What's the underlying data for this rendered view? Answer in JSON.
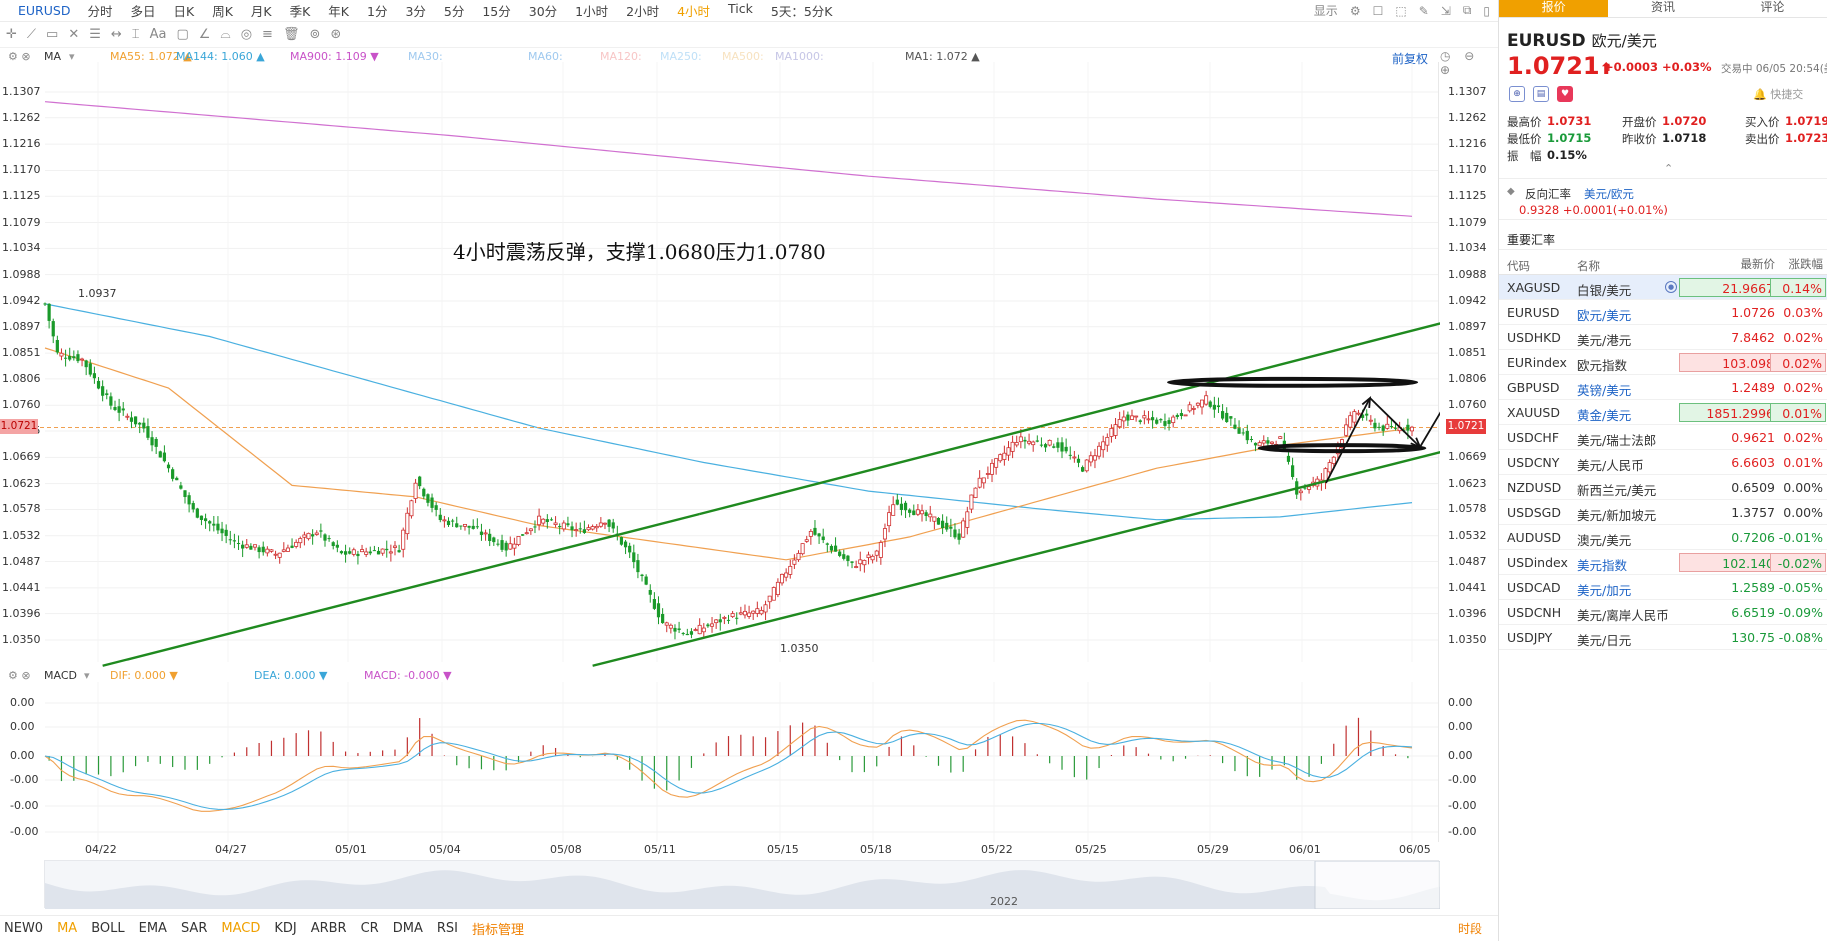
{
  "toolbar": {
    "symbol": "EURUSD",
    "periods": [
      "分时",
      "多日",
      "日K",
      "周K",
      "月K",
      "季K",
      "年K",
      "1分",
      "3分",
      "5分",
      "15分",
      "30分",
      "1小时",
      "2小时",
      "4小时",
      "Tick",
      "5天：5分K"
    ],
    "active_period": "4小时",
    "right": [
      "显示",
      "⚙",
      "☐",
      "⬚",
      "✎",
      "⇲",
      "⧉",
      "▯"
    ]
  },
  "drawtools": [
    "✛",
    "⟋",
    "▭",
    "✕",
    "☰",
    "↔",
    "⌶",
    "Aa",
    "▢",
    "∠",
    "⌓",
    "◎",
    "≡",
    "🗑",
    "⊚",
    "⊛"
  ],
  "ma_bar": {
    "label": "MA",
    "items": [
      {
        "text": "MA55: 1.072 ▲",
        "color": "#f0a030"
      },
      {
        "text": "MA144: 1.060 ▲",
        "color": "#3aa6d8"
      },
      {
        "text": "MA900: 1.109 ▼",
        "color": "#c852c8"
      },
      {
        "text": "MA30:",
        "color": "#9fc9ef"
      },
      {
        "text": "MA60:",
        "color": "#9fc9ef"
      },
      {
        "text": "MA120:",
        "color": "#f7c6c6"
      },
      {
        "text": "MA250:",
        "color": "#bfe0f7"
      },
      {
        "text": "MA500:",
        "color": "#f7e2c0"
      },
      {
        "text": "MA1000:",
        "color": "#c6c6e6"
      },
      {
        "text": "MA1: 1.072 ▲",
        "color": "#555555"
      }
    ],
    "restore": "前复权",
    "controls": "◷ ⊖ ⊕"
  },
  "macd_bar": {
    "label": "MACD",
    "items": [
      {
        "text": "DIF: 0.000 ▼",
        "color": "#f0a030"
      },
      {
        "text": "DEA: 0.000 ▼",
        "color": "#3aa6d8"
      },
      {
        "text": "MACD: -0.000 ▼",
        "color": "#c852c8"
      }
    ]
  },
  "annotation": "4小时震荡反弹，支撑1.0680压力1.0780",
  "labels": {
    "high": "1.0937",
    "low": "1.0350"
  },
  "current_price_tag": "1.0721",
  "chart_data": {
    "type": "candlestick",
    "symbol": "EURUSD",
    "period": "4小时",
    "y_ticks": [
      "1.1307",
      "1.1262",
      "1.1216",
      "1.1170",
      "1.1125",
      "1.1079",
      "1.1034",
      "1.0988",
      "1.0942",
      "1.0897",
      "1.0851",
      "1.0806",
      "1.0760",
      "1.0715",
      "1.0669",
      "1.0623",
      "1.0578",
      "1.0532",
      "1.0487",
      "1.0441",
      "1.0396",
      "1.0350"
    ],
    "ylim": [
      1.0305,
      1.133
    ],
    "x_labels": [
      "04/22",
      "04/27",
      "05/01",
      "05/04",
      "05/08",
      "05/11",
      "05/15",
      "05/18",
      "05/22",
      "05/25",
      "05/29",
      "06/01",
      "06/05"
    ],
    "x_year": "2022",
    "path": [
      [
        0,
        1.0937
      ],
      [
        3,
        1.085
      ],
      [
        9,
        1.084
      ],
      [
        16,
        1.076
      ],
      [
        24,
        1.072
      ],
      [
        30,
        1.065
      ],
      [
        36,
        1.0575
      ],
      [
        46,
        1.052
      ],
      [
        56,
        1.05
      ],
      [
        66,
        1.054
      ],
      [
        72,
        1.05
      ],
      [
        86,
        1.051
      ],
      [
        90,
        1.063
      ],
      [
        96,
        1.056
      ],
      [
        104,
        1.0545
      ],
      [
        112,
        1.051
      ],
      [
        120,
        1.056
      ],
      [
        130,
        1.054
      ],
      [
        136,
        1.056
      ],
      [
        142,
        1.05
      ],
      [
        150,
        1.038
      ],
      [
        156,
        1.036
      ],
      [
        166,
        1.039
      ],
      [
        174,
        1.04
      ],
      [
        180,
        1.047
      ],
      [
        186,
        1.054
      ],
      [
        196,
        1.048
      ],
      [
        202,
        1.05
      ],
      [
        206,
        1.059
      ],
      [
        216,
        1.056
      ],
      [
        222,
        1.053
      ],
      [
        226,
        1.062
      ],
      [
        236,
        1.07
      ],
      [
        246,
        1.069
      ],
      [
        252,
        1.065
      ],
      [
        262,
        1.074
      ],
      [
        272,
        1.073
      ],
      [
        282,
        1.077
      ],
      [
        288,
        1.073
      ],
      [
        294,
        1.069
      ],
      [
        300,
        1.07
      ],
      [
        304,
        1.061
      ],
      [
        310,
        1.063
      ],
      [
        318,
        1.075
      ],
      [
        324,
        1.072
      ],
      [
        332,
        1.0721
      ]
    ],
    "ma55": [
      [
        0,
        1.086
      ],
      [
        30,
        1.079
      ],
      [
        60,
        1.062
      ],
      [
        90,
        1.06
      ],
      [
        120,
        1.055
      ],
      [
        150,
        1.052
      ],
      [
        180,
        1.049
      ],
      [
        210,
        1.053
      ],
      [
        240,
        1.059
      ],
      [
        270,
        1.065
      ],
      [
        300,
        1.069
      ],
      [
        332,
        1.072
      ]
    ],
    "ma144": [
      [
        0,
        1.0937
      ],
      [
        40,
        1.088
      ],
      [
        80,
        1.08
      ],
      [
        120,
        1.072
      ],
      [
        160,
        1.066
      ],
      [
        200,
        1.061
      ],
      [
        240,
        1.058
      ],
      [
        270,
        1.056
      ],
      [
        300,
        1.0565
      ],
      [
        332,
        1.059
      ]
    ],
    "ma900": [
      [
        0,
        1.129
      ],
      [
        100,
        1.123
      ],
      [
        200,
        1.116
      ],
      [
        270,
        1.112
      ],
      [
        332,
        1.109
      ]
    ],
    "trendlines": [
      {
        "from": [
          14,
          1.0305
        ],
        "to": [
          159,
          1.057
        ],
        "color": "#1f8a1f"
      },
      {
        "from": [
          159,
          1.057
        ],
        "to": [
          360,
          1.0942
        ],
        "color": "#1f8a1f"
      },
      {
        "from": [
          133,
          1.0305
        ],
        "to": [
          340,
          1.068
        ],
        "color": "#1f8a1f"
      }
    ],
    "ellipses": [
      {
        "center": [
          303,
          1.08
        ],
        "rx": 30,
        "ry": 0.0006
      },
      {
        "center": [
          315,
          1.0685
        ],
        "rx": 20,
        "ry": 0.0004
      }
    ],
    "current": 1.0721,
    "macd": {
      "y_ticks": [
        "0.00",
        "0.00",
        "0.00",
        "-0.00",
        "-0.00",
        "-0.00"
      ]
    }
  },
  "bottom": {
    "indicators": [
      "NEW0",
      "MA",
      "BOLL",
      "EMA",
      "SAR",
      "MACD",
      "KDJ",
      "ARBR",
      "CR",
      "DMA",
      "RSI"
    ],
    "active": [
      "MA",
      "MACD"
    ],
    "manage": "指标管理",
    "shi": "时段"
  },
  "quote": {
    "tabs": [
      "报价",
      "资讯",
      "评论"
    ],
    "active_tab": "报价",
    "symbol": "EURUSD",
    "name": "欧元/美元",
    "price": "1.0721",
    "arrow": "⬆",
    "change": "+0.0003 +0.03%",
    "trade_status": "交易中 06/05 20:54(美",
    "fast_trade": "快捷交",
    "stats": [
      [
        {
          "k": "最高价",
          "v": "1.0731",
          "c": "rd"
        },
        {
          "k": "开盘价",
          "v": "1.0720",
          "c": "rd"
        },
        {
          "k": "买入价",
          "v": "1.0719",
          "c": "rd"
        }
      ],
      [
        {
          "k": "最低价",
          "v": "1.0715",
          "c": "g"
        },
        {
          "k": "昨收价",
          "v": "1.0718",
          "c": "k"
        },
        {
          "k": "卖出价",
          "v": "1.0723",
          "c": "rd"
        }
      ],
      [
        {
          "k": "振　幅",
          "v": "0.15%",
          "c": "k"
        }
      ]
    ],
    "reverse_label": "反向汇率",
    "reverse_pair": "美元/欧元",
    "reverse_value": "0.9328  +0.0001(+0.01%)",
    "important": "重要汇率"
  },
  "rates_table": {
    "headers": [
      "代码",
      "名称",
      "最新价",
      "涨跌幅"
    ],
    "rows": [
      {
        "code": "XAGUSD",
        "name": "白银/美元",
        "price": "21.9667",
        "pct": "0.14%",
        "dir": "pos",
        "pbox": "g",
        "qbox": "g",
        "sel": true,
        "namecolor": "#333"
      },
      {
        "code": "EURUSD",
        "name": "欧元/美元",
        "price": "1.0726",
        "pct": "0.03%",
        "dir": "pos",
        "pbox": "",
        "qbox": "",
        "namecolor": "#1e63c6"
      },
      {
        "code": "USDHKD",
        "name": "美元/港元",
        "price": "7.8462",
        "pct": "0.02%",
        "dir": "pos",
        "pbox": "",
        "qbox": "",
        "namecolor": "#333"
      },
      {
        "code": "EURindex",
        "name": "欧元指数",
        "price": "103.098",
        "pct": "0.02%",
        "dir": "pos",
        "pbox": "r",
        "qbox": "r",
        "namecolor": "#333"
      },
      {
        "code": "GBPUSD",
        "name": "英镑/美元",
        "price": "1.2489",
        "pct": "0.02%",
        "dir": "pos",
        "pbox": "",
        "qbox": "",
        "namecolor": "#1e63c6"
      },
      {
        "code": "XAUUSD",
        "name": "黄金/美元",
        "price": "1851.2996",
        "pct": "0.01%",
        "dir": "pos",
        "pbox": "g",
        "qbox": "g",
        "namecolor": "#1e63c6"
      },
      {
        "code": "USDCHF",
        "name": "美元/瑞士法郎",
        "price": "0.9621",
        "pct": "0.02%",
        "dir": "pos",
        "pbox": "",
        "qbox": "",
        "namecolor": "#333"
      },
      {
        "code": "USDCNY",
        "name": "美元/人民币",
        "price": "6.6603",
        "pct": "0.01%",
        "dir": "pos",
        "pbox": "",
        "qbox": "",
        "namecolor": "#333"
      },
      {
        "code": "NZDUSD",
        "name": "新西兰元/美元",
        "price": "0.6509",
        "pct": "0.00%",
        "dir": "flat",
        "pbox": "",
        "qbox": "",
        "namecolor": "#333"
      },
      {
        "code": "USDSGD",
        "name": "美元/新加坡元",
        "price": "1.3757",
        "pct": "0.00%",
        "dir": "flat",
        "pbox": "",
        "qbox": "",
        "namecolor": "#333"
      },
      {
        "code": "AUDUSD",
        "name": "澳元/美元",
        "price": "0.7206",
        "pct": "-0.01%",
        "dir": "neg",
        "pbox": "",
        "qbox": "",
        "namecolor": "#333"
      },
      {
        "code": "USDindex",
        "name": "美元指数",
        "price": "102.140",
        "pct": "-0.02%",
        "dir": "neg",
        "pbox": "r",
        "qbox": "r",
        "namecolor": "#1e63c6"
      },
      {
        "code": "USDCAD",
        "name": "美元/加元",
        "price": "1.2589",
        "pct": "-0.05%",
        "dir": "neg",
        "pbox": "",
        "qbox": "",
        "namecolor": "#1e63c6"
      },
      {
        "code": "USDCNH",
        "name": "美元/离岸人民币",
        "price": "6.6519",
        "pct": "-0.09%",
        "dir": "neg",
        "pbox": "",
        "qbox": "",
        "namecolor": "#333"
      },
      {
        "code": "USDJPY",
        "name": "美元/日元",
        "price": "130.75",
        "pct": "-0.08%",
        "dir": "neg",
        "pbox": "",
        "qbox": "",
        "namecolor": "#333"
      }
    ]
  }
}
